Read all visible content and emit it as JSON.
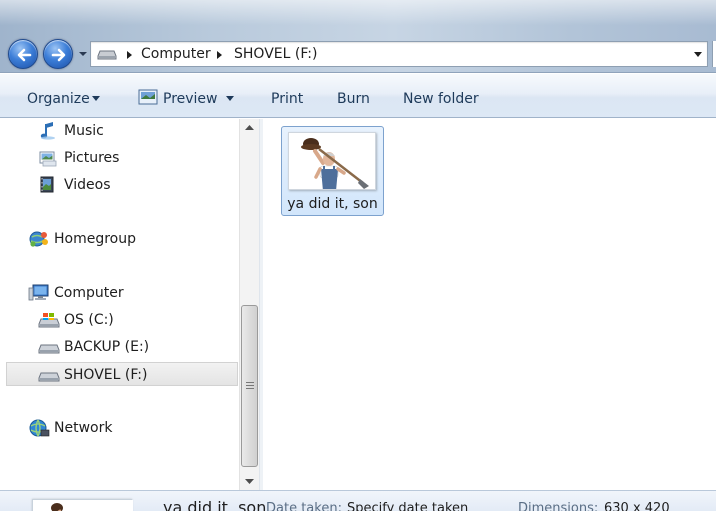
{
  "address": {
    "breadcrumbs": [
      "Computer",
      "SHOVEL (F:)"
    ]
  },
  "toolbar": {
    "organize": "Organize",
    "preview": "Preview",
    "print": "Print",
    "burn": "Burn",
    "new_folder": "New folder"
  },
  "nav": {
    "music": "Music",
    "pictures": "Pictures",
    "videos": "Videos",
    "homegroup": "Homegroup",
    "computer": "Computer",
    "drive_c": "OS (C:)",
    "drive_e": "BACKUP (E:)",
    "drive_f": "SHOVEL (F:)",
    "network": "Network"
  },
  "files": [
    {
      "name": "ya did it, son",
      "selected": true
    }
  ],
  "details": {
    "name": "ya did it, son",
    "date_taken_label": "Date taken:",
    "date_taken_value": "Specify date taken",
    "dimensions_label": "Dimensions:",
    "dimensions_value": "630 x 420"
  },
  "colors": {
    "selection": "#d2e6fb",
    "selection_border": "#7da2ce",
    "nav_button": "#3c7ed8"
  }
}
